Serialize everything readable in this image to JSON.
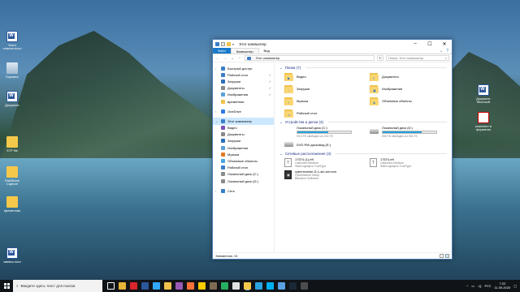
{
  "desktop": {
    "icons_left": [
      {
        "label": "Word планин.docx",
        "kind": "word"
      },
      {
        "label": "Корзина",
        "kind": "bin"
      },
      {
        "label": "Документ",
        "kind": "word"
      },
      {
        "label": "STP file",
        "kind": "folder"
      },
      {
        "label": "FastStone Capture",
        "kind": "tool"
      },
      {
        "label": "временная",
        "kind": "folder"
      },
      {
        "label": "заявка.docx",
        "kind": "word"
      }
    ],
    "icons_right": [
      {
        "label": "Документ Microsoft",
        "kind": "word"
      },
      {
        "label": "комплект в форматах",
        "kind": "pdf"
      }
    ]
  },
  "window": {
    "title": "Этот компьютер",
    "tabs": {
      "file": "Файл",
      "computer": "Компьютер",
      "view": "Вид"
    },
    "address": "Этот компьютер",
    "search_placeholder": "Поиск: Этот компьютер",
    "nav_items": [
      {
        "label": "Быстрый доступ",
        "level": 0,
        "icon": "star-icon",
        "color": "#3a7ec9",
        "pinned": false
      },
      {
        "label": "Рабочий стол",
        "level": 1,
        "icon": "desktop-icon",
        "color": "#3a7ec9",
        "pinned": true
      },
      {
        "label": "Загрузки",
        "level": 1,
        "icon": "download-icon",
        "color": "#2c6fbd",
        "pinned": true
      },
      {
        "label": "Документы",
        "level": 1,
        "icon": "documents-icon",
        "color": "#8a8a8a",
        "pinned": true
      },
      {
        "label": "Изображения",
        "level": 1,
        "icon": "pictures-icon",
        "color": "#5ba0d8",
        "pinned": true
      },
      {
        "label": "временная",
        "level": 1,
        "icon": "folder-icon",
        "color": "#f1c24b",
        "pinned": false
      },
      {
        "label": "",
        "level": -1
      },
      {
        "label": "OneDrive",
        "level": 0,
        "icon": "onedrive-icon",
        "color": "#2d7be5",
        "pinned": false
      },
      {
        "label": "",
        "level": -1
      },
      {
        "label": "Этот компьютер",
        "level": 0,
        "icon": "computer-icon",
        "color": "#3a7ec9",
        "pinned": false,
        "selected": true
      },
      {
        "label": "Видео",
        "level": 1,
        "icon": "video-icon",
        "color": "#7b4fb8",
        "pinned": false
      },
      {
        "label": "Документы",
        "level": 1,
        "icon": "documents-icon",
        "color": "#8a8a8a",
        "pinned": false
      },
      {
        "label": "Загрузки",
        "level": 1,
        "icon": "download-icon",
        "color": "#2c6fbd",
        "pinned": false
      },
      {
        "label": "Изображения",
        "level": 1,
        "icon": "pictures-icon",
        "color": "#5ba0d8",
        "pinned": false
      },
      {
        "label": "Музыка",
        "level": 1,
        "icon": "music-icon",
        "color": "#e07b24",
        "pinned": false
      },
      {
        "label": "Объемные объекты",
        "level": 1,
        "icon": "3d-objects-icon",
        "color": "#4aa3df",
        "pinned": false
      },
      {
        "label": "Рабочий стол",
        "level": 1,
        "icon": "desktop-icon",
        "color": "#3a7ec9",
        "pinned": false
      },
      {
        "label": "Локальный диск (C:)",
        "level": 1,
        "icon": "drive-icon",
        "color": "#8a8a8a",
        "pinned": false
      },
      {
        "label": "Локальный диск (D:)",
        "level": 1,
        "icon": "drive-icon",
        "color": "#8a8a8a",
        "pinned": false
      },
      {
        "label": "",
        "level": -1
      },
      {
        "label": "Сеть",
        "level": 0,
        "icon": "network-icon",
        "color": "#3a7ec9",
        "pinned": false
      }
    ],
    "sections": {
      "folders": "Папки (7)",
      "devices": "Устройства и диски (3)",
      "network": "Сетевые расположения (3)"
    },
    "folders": [
      {
        "label": "Видео",
        "glyph": "▶"
      },
      {
        "label": "Документы",
        "glyph": "≡"
      },
      {
        "label": "Загрузки",
        "glyph": "↓"
      },
      {
        "label": "Изображения",
        "glyph": "▣"
      },
      {
        "label": "Музыка",
        "glyph": "♪"
      },
      {
        "label": "Объемные объекты",
        "glyph": "◈"
      },
      {
        "label": "Рабочий стол",
        "glyph": "▭"
      }
    ],
    "drives": [
      {
        "label": "Локальный диск (C:)",
        "free": "93,3 ГБ свободно из 222 ГБ",
        "used_fraction": 0.58,
        "system": true
      },
      {
        "label": "Локальный диск (D:)",
        "free": "250 ГБ свободно из 931 ГБ",
        "used_fraction": 0.73,
        "system": false
      },
      {
        "label": "DVD RW дисковод (E:)",
        "free": "",
        "used_fraction": null,
        "system": false
      }
    ],
    "network": [
      {
        "title": "17574 (1).eft",
        "line2": "Calisonbo Medium",
        "line3": "Файл шрифта TrueType",
        "kind": "font"
      },
      {
        "title": "17574.eft",
        "line2": "Calisonbo Medium",
        "line3": "Файл шрифта TrueType",
        "kind": "font"
      },
      {
        "title": "cyberrnarine-D-1-sin-win.exe",
        "line2": "CyberMarine Setup",
        "line3": "Blackbox Software",
        "kind": "app"
      }
    ],
    "status": "Элементов: 13"
  },
  "taskbar": {
    "search_placeholder": "Введите здесь текст для поиска",
    "apps": [
      {
        "name": "task-view-icon",
        "color": "#ffffff"
      },
      {
        "name": "chrome-icon",
        "color": "#e8b33a"
      },
      {
        "name": "opera-icon",
        "color": "#d9242a"
      },
      {
        "name": "word-app-icon",
        "color": "#2b579a"
      },
      {
        "name": "photoshop-icon",
        "color": "#31a8ff"
      },
      {
        "name": "files-icon",
        "color": "#f1c24b"
      },
      {
        "name": "media-icon",
        "color": "#9b59b6"
      },
      {
        "name": "firefox-icon",
        "color": "#ff7139"
      },
      {
        "name": "yandex-icon",
        "color": "#ffcc00"
      },
      {
        "name": "archive-icon",
        "color": "#7d6b54"
      },
      {
        "name": "greenshot-icon",
        "color": "#27ae60"
      },
      {
        "name": "calendar-icon",
        "color": "#e0e0e0"
      },
      {
        "name": "explorer-icon",
        "color": "#f6c84a"
      },
      {
        "name": "telegram-icon",
        "color": "#2aa3df"
      },
      {
        "name": "skype-icon",
        "color": "#00aff0"
      },
      {
        "name": "photos-icon",
        "color": "#5aa1e3"
      },
      {
        "name": "steam-icon",
        "color": "#1b2838"
      },
      {
        "name": "obs-icon",
        "color": "#4c4c4c"
      }
    ],
    "lang": "РУС",
    "time": "7:22",
    "date": "11.09.2020"
  }
}
